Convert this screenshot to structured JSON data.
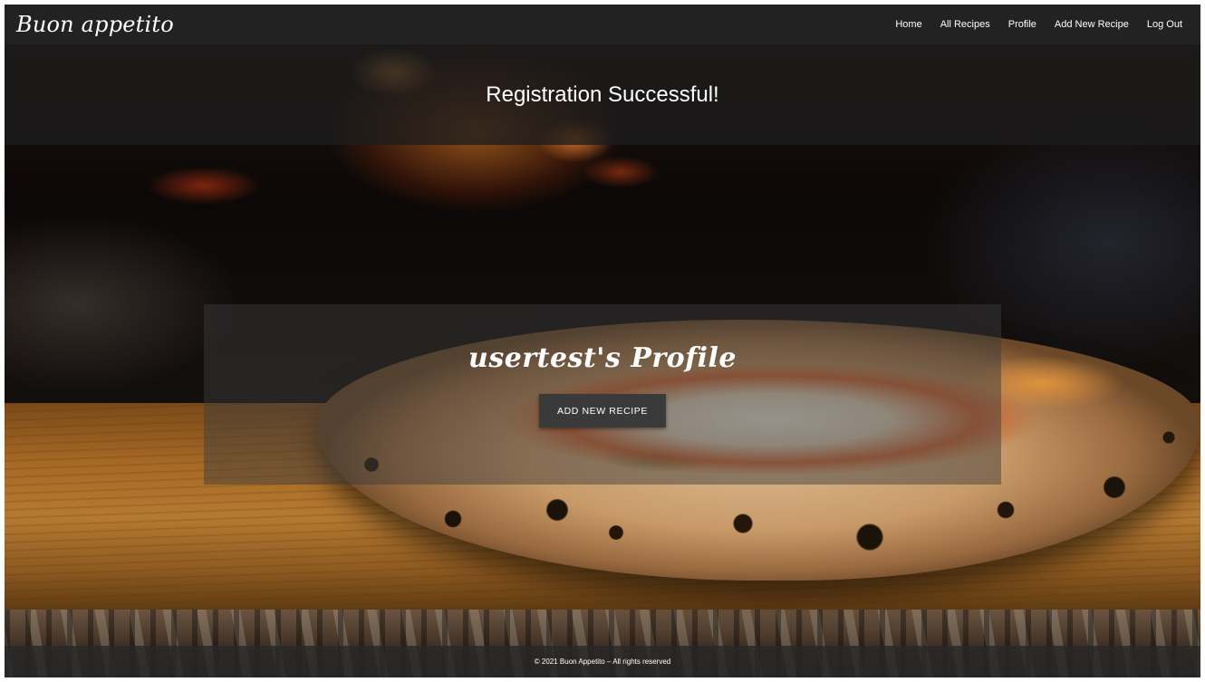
{
  "navbar": {
    "brand": "Buon appetito",
    "links": [
      {
        "label": "Home"
      },
      {
        "label": "All Recipes"
      },
      {
        "label": "Profile"
      },
      {
        "label": "Add New Recipe"
      },
      {
        "label": "Log Out"
      }
    ]
  },
  "flash": {
    "message": "Registration Successful!"
  },
  "profile": {
    "title": "usertest's Profile",
    "add_recipe_button": "Add New Recipe"
  },
  "footer": {
    "text": "© 2021 Buon Appetito – All rights reserved"
  },
  "colors": {
    "navbar_bg": "#222222",
    "button_bg": "#3a3a3a",
    "text": "#ffffff"
  }
}
